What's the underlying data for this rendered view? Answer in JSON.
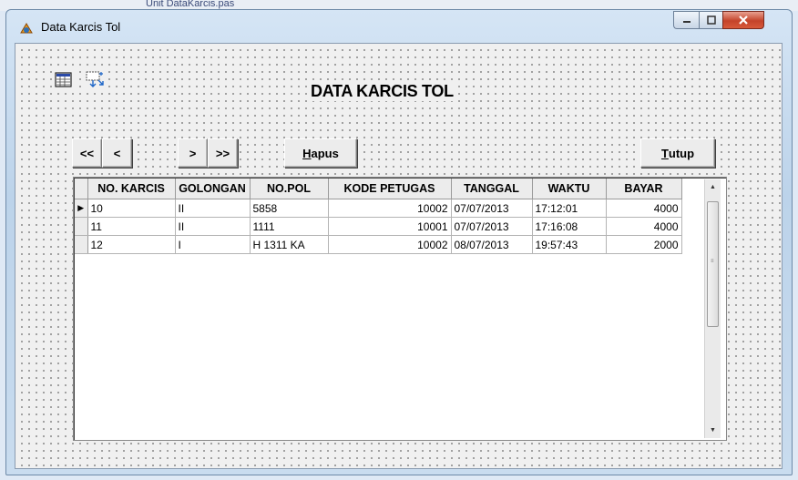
{
  "background": {
    "ghost_text": "Unit DataKarcis.pas"
  },
  "window": {
    "title": "Data Karcis Tol",
    "app_icon": "delphi-helmet-icon",
    "controls": [
      "minimize-icon",
      "maximize-icon",
      "close-icon"
    ]
  },
  "form": {
    "title": "DATA KARCIS TOL",
    "tool_icons": [
      "table-component-icon",
      "data-source-icon"
    ]
  },
  "navigator": {
    "first": "<<",
    "prior": "<",
    "next": ">",
    "last": ">>"
  },
  "buttons": {
    "hapus": {
      "mnemonic": "H",
      "rest": "apus"
    },
    "tutup": {
      "mnemonic": "T",
      "rest": "utup"
    }
  },
  "grid": {
    "columns": [
      "NO. KARCIS",
      "GOLONGAN",
      "NO.POL",
      "KODE PETUGAS",
      "TANGGAL",
      "WAKTU",
      "BAYAR"
    ],
    "current_row_indicator": "▶",
    "rows": [
      [
        "10",
        "II",
        "5858",
        "10002",
        "07/07/2013",
        "17:12:01",
        "4000"
      ],
      [
        "11",
        "II",
        "1111",
        "10001",
        "07/07/2013",
        "17:16:08",
        "4000"
      ],
      [
        "12",
        "I",
        "H 1311 KA",
        "10002",
        "08/07/2013",
        "19:57:43",
        "2000"
      ]
    ]
  },
  "colors": {
    "client_bg": "#f0f0f0",
    "close_button": "#c4432a",
    "title_bar": "#c9dcef"
  }
}
